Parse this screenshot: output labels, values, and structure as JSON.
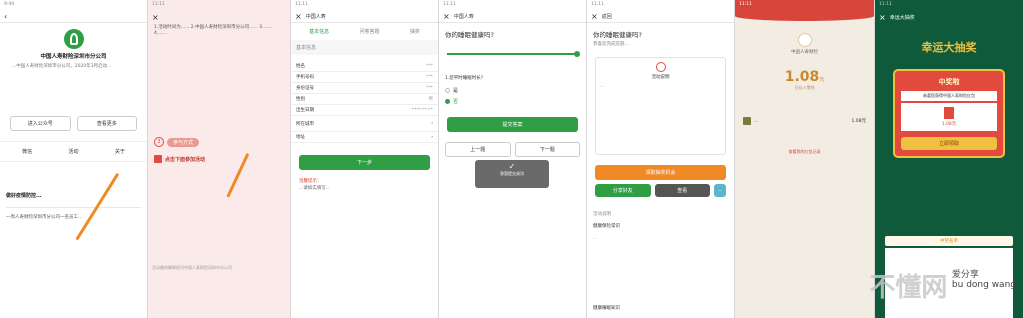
{
  "phone1": {
    "status": "9:49",
    "company": "中国人寿财险深圳市分公司",
    "intro": "...中国人寿财险深圳市分公司，2020年3月启动...",
    "buttons": [
      "进入公众号",
      "查看更多"
    ],
    "tabs": [
      "微信",
      "活动",
      "关于"
    ],
    "item_title": "做好疫情防控...",
    "item_text": "一周人寿财险深圳市分公司一名员工..."
  },
  "phone2": {
    "status": "11:11",
    "text": "1.活动时间为...... 2.中国人寿财险深圳市分公司...... 3....... 4.......",
    "step_label": "参与方式",
    "step_number": "3",
    "click_label": "点击下面参加活动",
    "footer_note": "活动最终解释权归中国人寿财险深圳市分公司"
  },
  "phone3": {
    "status": "11:11",
    "title": "中国人寿",
    "steps": [
      "基本信息",
      "问卷答题",
      "抽奖"
    ],
    "section": "基本信息",
    "fields": [
      {
        "label": "姓名",
        "value": "***"
      },
      {
        "label": "手机号码",
        "value": "***"
      },
      {
        "label": "身份证号",
        "value": "***"
      },
      {
        "label": "性别",
        "value": "男"
      },
      {
        "label": "出生日期",
        "value": "****-**-**"
      },
      {
        "label": "所在城市",
        "value": ""
      },
      {
        "label": "地址",
        "value": ""
      }
    ],
    "next_button": "下一步",
    "note_title": "温馨提示：",
    "note_text": "...请如实填写..."
  },
  "phone4": {
    "status": "11:11",
    "title": "中国人寿",
    "question": "你的睡眠健康吗?",
    "option_a": "是",
    "option_b": "否",
    "q2": "1.您平时睡眠时长?",
    "submit_button": "提交答案",
    "toast": "答案提交成功",
    "prev_button": "上一题",
    "next_button": "下一题"
  },
  "phone5": {
    "status": "11:11",
    "title": "返回",
    "heading": "你的睡眠健康吗?",
    "subheading": "恭喜您完成答题...",
    "card_title": "活动说明",
    "card_text": "...",
    "main_button": "领取抽奖机会",
    "btns": [
      "分享好友",
      "查看",
      "..."
    ],
    "list_title": "活动说明",
    "list_items": [
      "健康保险常识",
      "...",
      "健康睡眠知识"
    ]
  },
  "phone6": {
    "status": "11:11",
    "org": "中国人寿财险",
    "amount": "1.08",
    "unit": "元",
    "note": "已存入零钱",
    "row_name": "...",
    "row_amount": "1.08元",
    "link": "查看我的红包记录"
  },
  "phone7": {
    "status": "11:11",
    "title": "幸运大抽奖",
    "banner": "幸运大抽奖",
    "prize_title": "中奖啦",
    "prize_text": "恭喜您获得中国人寿财险红包",
    "prize_amount": "1.08元",
    "claim_button": "立即领取",
    "section": "中奖名单"
  },
  "watermark": {
    "main": "不懂网",
    "side": "爱分享",
    "latin": "bu dong wang"
  },
  "colors": {
    "green": "#2f9e44",
    "orange": "#f08a24",
    "red": "#e14a3c",
    "gold": "#f0c040"
  }
}
